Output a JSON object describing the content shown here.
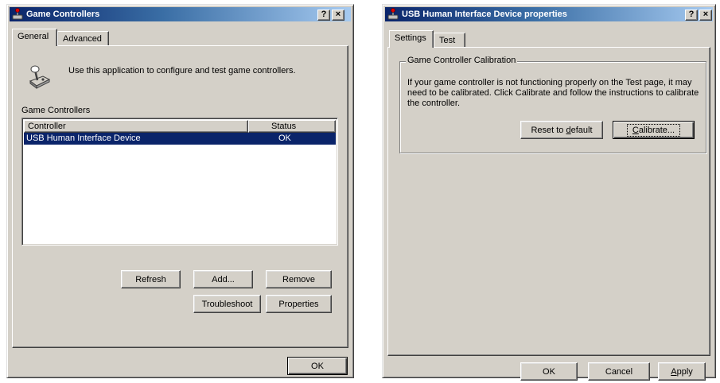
{
  "left_dialog": {
    "title": "Game Controllers",
    "help_button": "?",
    "close_button": "×",
    "tabs": [
      "General",
      "Advanced"
    ],
    "description": "Use this application to configure and test game controllers.",
    "icon": "joystick-icon",
    "group_label": "Game Controllers",
    "columns": {
      "controller": "Controller",
      "status": "Status"
    },
    "rows": [
      {
        "controller": "USB Human Interface Device",
        "status": "OK",
        "selected": true
      }
    ],
    "buttons": {
      "refresh": "Refresh",
      "add": "Add...",
      "remove": "Remove",
      "troubleshoot": "Troubleshoot",
      "properties": "Properties"
    },
    "ok": "OK"
  },
  "right_dialog": {
    "title": "USB Human Interface Device properties",
    "help_button": "?",
    "close_button": "×",
    "tabs": [
      "Settings",
      "Test"
    ],
    "group_title": "Game Controller Calibration",
    "calibration_text": "If your game controller is not functioning properly on the Test page, it may need to be calibrated.  Click Calibrate and follow the instructions to calibrate the controller.",
    "reset_button": {
      "before": "Reset to ",
      "accel": "d",
      "after": "efault"
    },
    "calibrate_button": {
      "accel": "C",
      "after": "alibrate..."
    },
    "ok": "OK",
    "cancel": "Cancel",
    "apply": {
      "accel": "A",
      "after": "pply"
    }
  },
  "colors": {
    "face": "#d4d0c8",
    "title_active": "#0a246a",
    "selection": "#0a246a"
  }
}
